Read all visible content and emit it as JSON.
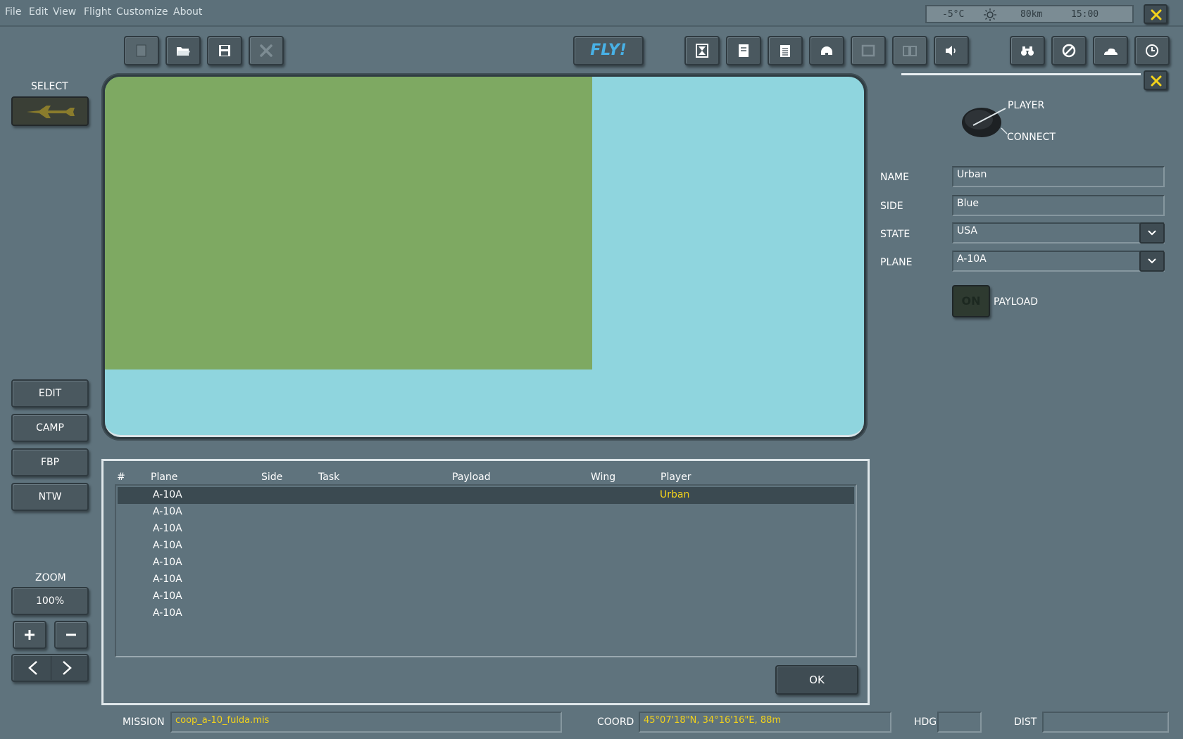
{
  "menu": [
    "File",
    "Edit",
    "View",
    "Flight",
    "Customize",
    "About"
  ],
  "status": {
    "temperature": "-5°C",
    "visibility": "80km",
    "time": "15:00"
  },
  "toolbar": {
    "fly_label": "FLY!"
  },
  "left": {
    "select_label": "SELECT",
    "buttons": [
      "EDIT",
      "CAMP",
      "FBP",
      "NTW"
    ],
    "zoom_label": "ZOOM",
    "zoom_value": "100%"
  },
  "player_panel": {
    "player_label": "PLAYER",
    "connect_label": "CONNECT",
    "name_label": "NAME",
    "name_value": "Urban",
    "side_label": "SIDE",
    "side_value": "Blue",
    "state_label": "STATE",
    "state_value": "USA",
    "plane_label": "PLANE",
    "plane_value": "A-10A",
    "payload_toggle": "ON",
    "payload_label": "PAYLOAD"
  },
  "table": {
    "columns": [
      "#",
      "Plane",
      "Side",
      "Task",
      "Payload",
      "Wing",
      "Player"
    ],
    "rows": [
      {
        "plane": "A-10A",
        "player": "Urban"
      },
      {
        "plane": "A-10A",
        "player": ""
      },
      {
        "plane": "A-10A",
        "player": ""
      },
      {
        "plane": "A-10A",
        "player": ""
      },
      {
        "plane": "A-10A",
        "player": ""
      },
      {
        "plane": "A-10A",
        "player": ""
      },
      {
        "plane": "A-10A",
        "player": ""
      },
      {
        "plane": "A-10A",
        "player": ""
      }
    ],
    "ok_label": "OK"
  },
  "bottom": {
    "mission_label": "MISSION",
    "mission_value": "coop_a-10_fulda.mis",
    "coord_label": "COORD",
    "coord_value": "45°07'18\"N, 34°16'16\"E, 88m",
    "hdg_label": "HDG",
    "hdg_value": "",
    "dist_label": "DIST",
    "dist_value": ""
  },
  "colors": {
    "map_water": "#8fd5de",
    "map_land": "#7ea962",
    "highlight_text": "#f2d21b",
    "fly_text": "#48b1e6"
  }
}
